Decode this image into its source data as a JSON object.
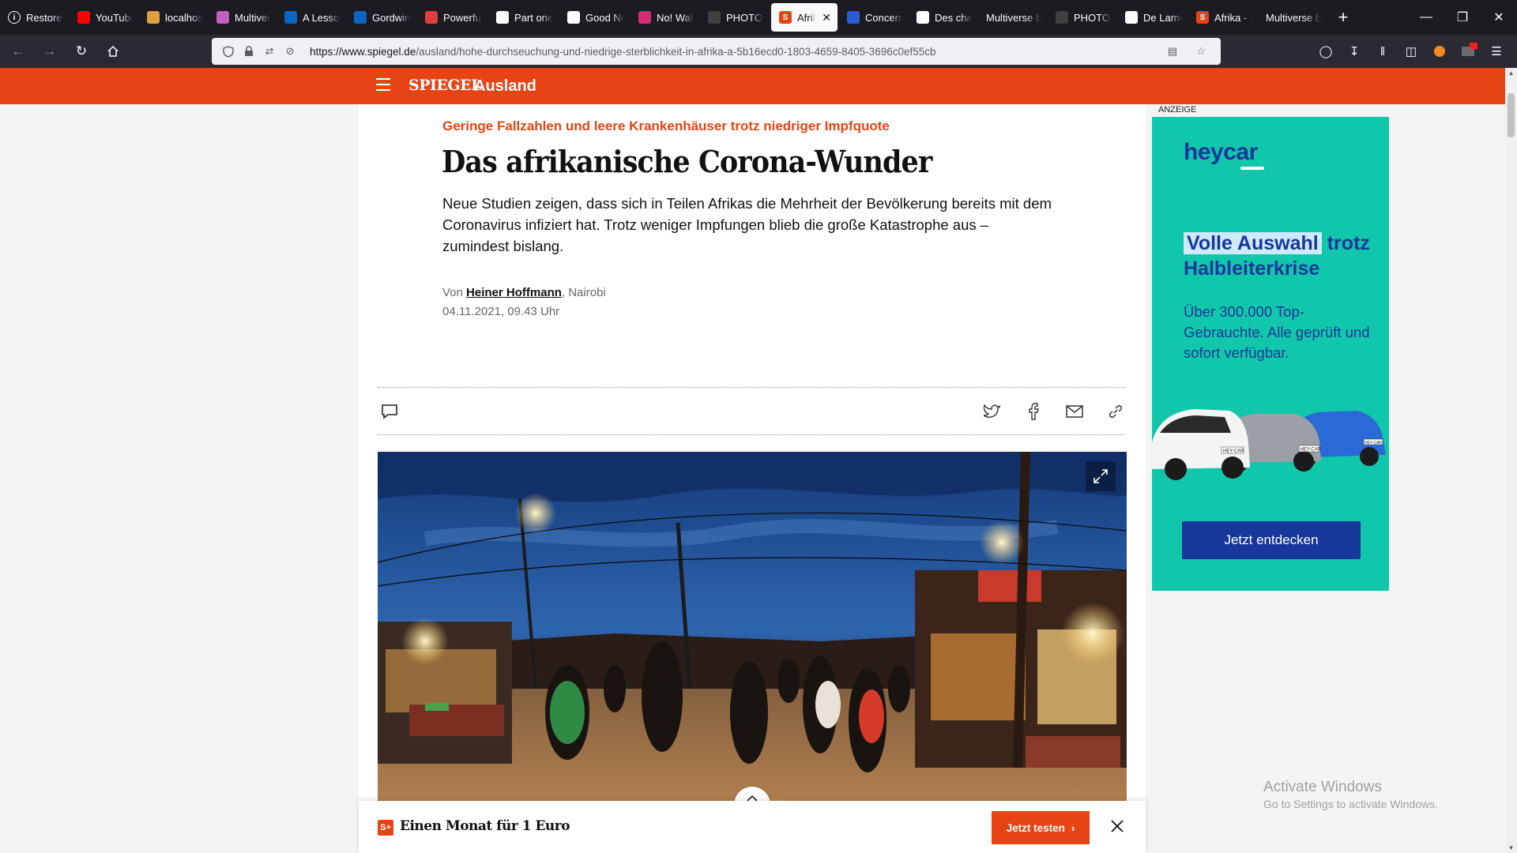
{
  "browser": {
    "tabs": [
      {
        "title": "Restore Session",
        "icon": "info-icon",
        "color": "#1c1b22"
      },
      {
        "title": "YouTube",
        "icon": "youtube-icon",
        "color": "#ff0000"
      },
      {
        "title": "localhost",
        "icon": "localhost-icon",
        "color": "#e0a040"
      },
      {
        "title": "Multiverse",
        "icon": "multiverse-icon",
        "color": "#c060c0"
      },
      {
        "title": "A Lesson",
        "icon": "linkedin-icon",
        "color": "#0a66c2"
      },
      {
        "title": "Gordwin",
        "icon": "linkedin-icon",
        "color": "#0a66c2"
      },
      {
        "title": "Powerful",
        "icon": "powerful-icon",
        "color": "#e04040"
      },
      {
        "title": "Part one",
        "icon": "notion-icon",
        "color": "#ffffff"
      },
      {
        "title": "Good Ne",
        "icon": "gn-icon",
        "color": "#ffffff"
      },
      {
        "title": "No! Wah",
        "icon": "instagram-icon",
        "color": "#d62976"
      },
      {
        "title": "PHOTOS",
        "icon": "photos-icon",
        "color": "#404040"
      },
      {
        "title": "Afrika",
        "icon": "spiegel-icon",
        "color": "#e64415",
        "active": true
      },
      {
        "title": "Concern",
        "icon": "concern-icon",
        "color": "#2a5bd7"
      },
      {
        "title": "Des char",
        "icon": "f-icon",
        "color": "#ffffff"
      },
      {
        "title": "Multiverse b",
        "icon": "none",
        "color": "#1c1b22"
      },
      {
        "title": "PHOTOS",
        "icon": "photos-icon",
        "color": "#404040"
      },
      {
        "title": "De Lamu",
        "icon": "m-icon",
        "color": "#ffffff"
      },
      {
        "title": "Afrika - I",
        "icon": "spiegel-icon",
        "color": "#e64415"
      },
      {
        "title": "Multiverse b",
        "icon": "none",
        "color": "#1c1b22"
      }
    ],
    "url_domain": "https://www.spiegel.de",
    "url_path": "/ausland/hohe-durchseuchung-und-niedrige-sterblichkeit-in-afrika-a-5b16ecd0-1803-4659-8405-3696c0ef55cb"
  },
  "site": {
    "logo": "SPIEGEL",
    "section": "Ausland"
  },
  "article": {
    "kicker": "Geringe Fallzahlen und leere Krankenhäuser trotz niedriger Impfquote",
    "headline": "Das afrikanische Corona-Wunder",
    "intro": "Neue Studien zeigen, dass sich in Teilen Afrikas die Mehrheit der Bevölkerung bereits mit dem Coronavirus infiziert hat. Trotz weniger Impfungen blieb die große Katastrophe aus – zumindest bislang.",
    "byline_prefix": "Von",
    "author": "Heiner Hoffmann",
    "location": ", Nairobi",
    "date": "04.11.2021, 09.43 Uhr"
  },
  "ad": {
    "label": "ANZEIGE",
    "brand": "heycar",
    "headline_highlight": "Volle Auswahl",
    "headline_rest": " trotz Halbleiterkrise",
    "body": "Über 300.000 Top-Gebrauchte. Alle geprüft und sofort verfügbar.",
    "cta": "Jetzt entdecken",
    "plates": [
      "HEY-CAR",
      "HEY-CAR",
      "HEY-CAR"
    ]
  },
  "promo": {
    "badge": "S+",
    "text": "Einen Monat für 1 Euro",
    "button": "Jetzt testen"
  },
  "watermark": {
    "line1": "Activate Windows",
    "line2": "Go to Settings to activate Windows."
  }
}
